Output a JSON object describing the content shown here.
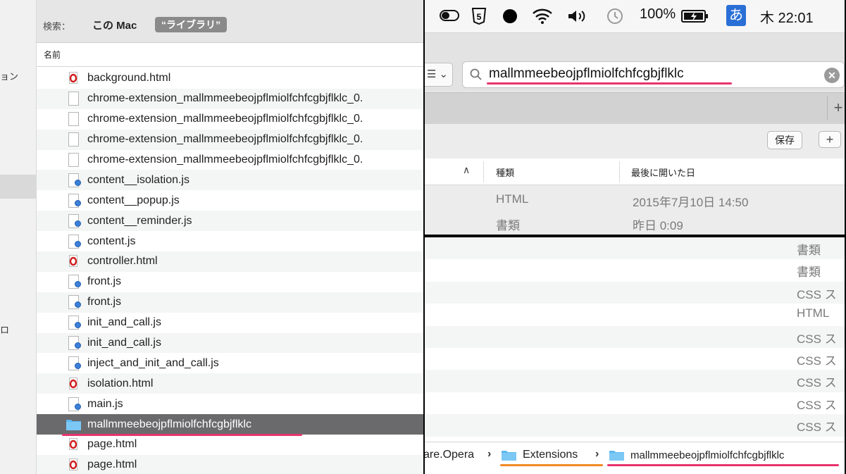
{
  "finder_window": {
    "scope": {
      "label": "検索：",
      "this_mac": "この Mac",
      "library_token": "“ライブラリ”"
    },
    "sidebar_fragments": [
      "ョン",
      "ロ"
    ],
    "column_header": "名前",
    "files": [
      {
        "name": "background.html",
        "icon": "opera-html-icon"
      },
      {
        "name": "chrome-extension_mallmmeebeojpflmiolfchfcgbjflklc_0.",
        "icon": "document-icon"
      },
      {
        "name": "chrome-extension_mallmmeebeojpflmiolfchfcgbjflklc_0.",
        "icon": "document-icon"
      },
      {
        "name": "chrome-extension_mallmmeebeojpflmiolfchfcgbjflklc_0.",
        "icon": "document-icon"
      },
      {
        "name": "chrome-extension_mallmmeebeojpflmiolfchfcgbjflklc_0.",
        "icon": "document-icon"
      },
      {
        "name": "content__isolation.js",
        "icon": "js-file-icon"
      },
      {
        "name": "content__popup.js",
        "icon": "js-file-icon"
      },
      {
        "name": "content__reminder.js",
        "icon": "js-file-icon"
      },
      {
        "name": "content.js",
        "icon": "js-file-icon"
      },
      {
        "name": "controller.html",
        "icon": "opera-html-icon"
      },
      {
        "name": "front.js",
        "icon": "js-file-icon"
      },
      {
        "name": "front.js",
        "icon": "js-file-icon"
      },
      {
        "name": "init_and_call.js",
        "icon": "js-file-icon"
      },
      {
        "name": "init_and_call.js",
        "icon": "js-file-icon"
      },
      {
        "name": "inject_and_init_and_call.js",
        "icon": "js-file-icon"
      },
      {
        "name": "isolation.html",
        "icon": "opera-html-icon"
      },
      {
        "name": "main.js",
        "icon": "js-file-icon"
      },
      {
        "name": "mallmmeebeojpflmiolfchfcgbjflklc",
        "icon": "folder-icon",
        "selected": true
      },
      {
        "name": "page.html",
        "icon": "opera-html-icon"
      },
      {
        "name": "page.html",
        "icon": "opera-html-icon"
      }
    ],
    "highlight_color": "#e8336d"
  },
  "menubar": {
    "status_items": [
      "battery-toggle-icon",
      "html5-icon",
      "black-dot-icon",
      "wifi-icon",
      "volume-icon",
      "time-machine-icon"
    ],
    "battery_percent": "100%",
    "input_method": "あ",
    "clock": "木 22:01"
  },
  "search_window": {
    "view_button": "☰ ⌄",
    "search_query": "mallmmeebeojpflmiolfchfcgbjflklc",
    "tab_add": "+",
    "save_label": "保存",
    "add_label": "+",
    "columns": {
      "kind": "種類",
      "last_opened": "最後に開いた日"
    },
    "results": [
      {
        "kind": "HTML",
        "date": "2015年7月10日 14:50"
      },
      {
        "kind": "書類",
        "date": "昨日 0:09"
      }
    ]
  },
  "finder_bottom": {
    "kinds": [
      "書類",
      "書類",
      "CSS ス",
      "HTML",
      "CSS ス",
      "CSS ス",
      "CSS ス",
      "CSS ス",
      "CSS ス"
    ],
    "path": {
      "parent": "are.Opera",
      "extensions": "Extensions",
      "current": "mallmmeebeojpflmiolfchfcgbjflklc"
    },
    "colors": {
      "folder": "#5db8f0",
      "orange_underline": "#f08a24"
    }
  }
}
